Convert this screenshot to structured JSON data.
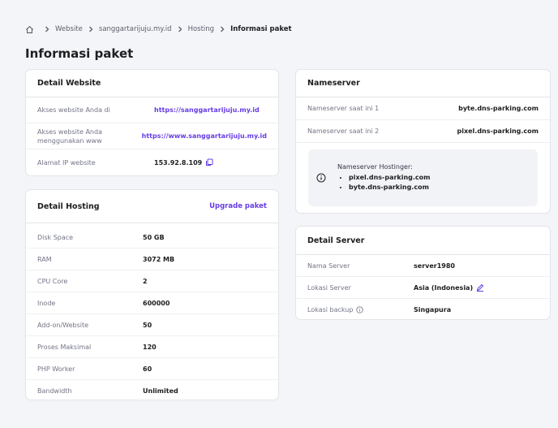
{
  "breadcrumb": {
    "items": [
      "Website",
      "sanggartarijuju.my.id",
      "Hosting"
    ],
    "current": "Informasi paket"
  },
  "page": {
    "title": "Informasi paket"
  },
  "website": {
    "title": "Detail Website",
    "rows": [
      {
        "label": "Akses website Anda di",
        "value": "https://sanggartarijuju.my.id"
      },
      {
        "label": "Akses website Anda menggunakan www",
        "value": "https://www.sanggartarijuju.my.id"
      },
      {
        "label": "Alamat IP website",
        "value": "153.92.8.109"
      }
    ]
  },
  "hosting": {
    "title": "Detail Hosting",
    "upgrade_label": "Upgrade paket",
    "rows": [
      {
        "label": "Disk Space",
        "value": "50 GB"
      },
      {
        "label": "RAM",
        "value": "3072 MB"
      },
      {
        "label": "CPU Core",
        "value": "2"
      },
      {
        "label": "Inode",
        "value": "600000"
      },
      {
        "label": "Add-on/Website",
        "value": "50"
      },
      {
        "label": "Proses Maksimal",
        "value": "120"
      },
      {
        "label": "PHP Worker",
        "value": "60"
      },
      {
        "label": "Bandwidth",
        "value": "Unlimited"
      }
    ]
  },
  "nameserver": {
    "title": "Nameserver",
    "rows": [
      {
        "label": "Nameserver saat ini 1",
        "value": "byte.dns-parking.com"
      },
      {
        "label": "Nameserver saat ini 2",
        "value": "pixel.dns-parking.com"
      }
    ],
    "info": {
      "title": "Nameserver Hostinger:",
      "items": [
        "pixel.dns-parking.com",
        "byte.dns-parking.com"
      ]
    }
  },
  "server": {
    "title": "Detail Server",
    "rows": [
      {
        "label": "Nama Server",
        "value": "server1980"
      },
      {
        "label": "Lokasi Server",
        "value": "Asia (Indonesia)"
      },
      {
        "label": "Lokasi backup",
        "value": "Singapura"
      }
    ]
  },
  "colors": {
    "accent": "#673de6",
    "background": "#f4f5f9",
    "card": "#ffffff"
  },
  "icons": [
    "home-icon",
    "chevron-right-icon",
    "copy-icon",
    "info-icon",
    "pencil-icon"
  ]
}
